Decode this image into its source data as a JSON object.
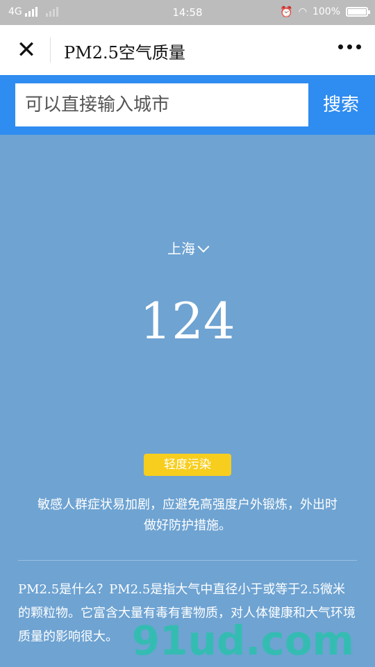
{
  "status_bar": {
    "network": "4G",
    "time": "14:58",
    "battery": "100%"
  },
  "nav": {
    "title": "PM2.5空气质量"
  },
  "search": {
    "placeholder": "可以直接输入城市",
    "button_label": "搜索"
  },
  "city": {
    "name": "上海"
  },
  "aqi": {
    "value": "124",
    "level": "轻度污染",
    "level_color": "#f7ce1e"
  },
  "advice": "敏感人群症状易加剧，应避免高强度户外锻炼，外出时做好防护措施。",
  "info": "PM2.5是什么？PM2.5是指大气中直径小于或等于2.5微米的颗粒物。它富含大量有毒有害物质，对人体健康和大气环境质量的影响很大。",
  "colors": {
    "accent": "#2f8cf0",
    "background": "#6ea3d2"
  },
  "watermark": {
    "text": "91ud.com"
  }
}
